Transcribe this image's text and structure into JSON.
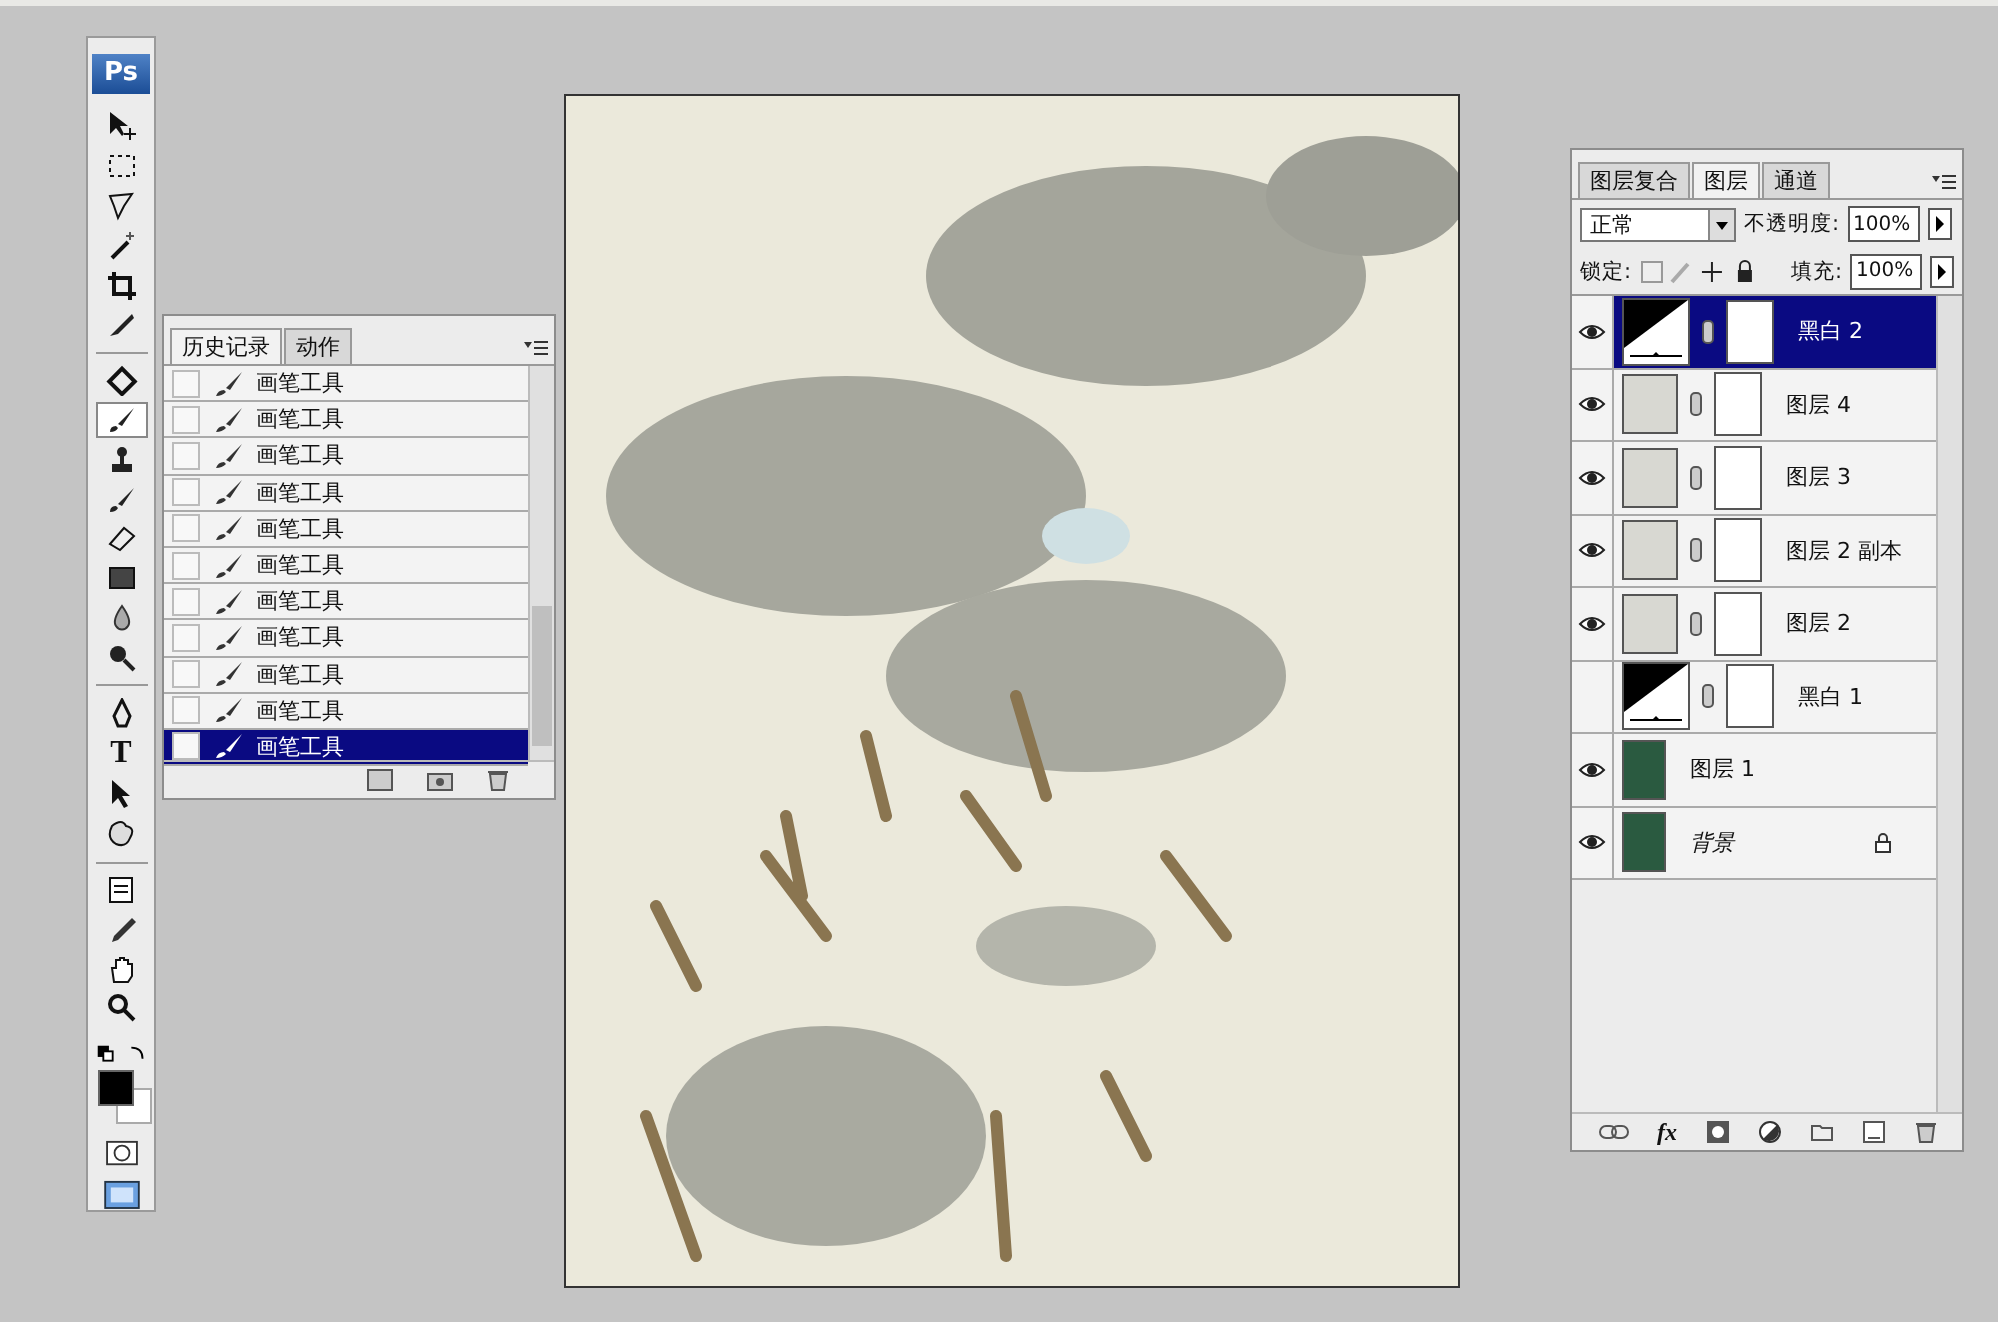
{
  "toolbar": {
    "logo": "Ps",
    "tools": [
      {
        "kind": "move",
        "selected": false
      },
      {
        "kind": "marquee",
        "selected": false
      },
      {
        "kind": "lasso",
        "selected": false
      },
      {
        "kind": "wand",
        "selected": false
      },
      {
        "kind": "crop",
        "selected": false
      },
      {
        "kind": "slice",
        "selected": false
      },
      {
        "kind": "heal",
        "selected": false
      },
      {
        "kind": "brush",
        "selected": true
      },
      {
        "kind": "stamp",
        "selected": false
      },
      {
        "kind": "historybrush",
        "selected": false
      },
      {
        "kind": "eraser",
        "selected": false
      },
      {
        "kind": "gradient",
        "selected": false
      },
      {
        "kind": "blur",
        "selected": false
      },
      {
        "kind": "dodge",
        "selected": false
      },
      {
        "kind": "pen",
        "selected": false
      },
      {
        "kind": "text",
        "selected": false
      },
      {
        "kind": "select",
        "selected": false
      },
      {
        "kind": "shape",
        "selected": false
      },
      {
        "kind": "notes",
        "selected": false
      },
      {
        "kind": "eyedropper",
        "selected": false
      },
      {
        "kind": "hand",
        "selected": false
      },
      {
        "kind": "zoom",
        "selected": false
      }
    ],
    "text_tool_glyph": "T"
  },
  "history_panel": {
    "tabs": [
      {
        "label": "历史记录",
        "selected": true
      },
      {
        "label": "动作",
        "selected": false
      }
    ],
    "items": [
      {
        "label": "画笔工具",
        "selected": false
      },
      {
        "label": "画笔工具",
        "selected": false
      },
      {
        "label": "画笔工具",
        "selected": false
      },
      {
        "label": "画笔工具",
        "selected": false
      },
      {
        "label": "画笔工具",
        "selected": false
      },
      {
        "label": "画笔工具",
        "selected": false
      },
      {
        "label": "画笔工具",
        "selected": false
      },
      {
        "label": "画笔工具",
        "selected": false
      },
      {
        "label": "画笔工具",
        "selected": false
      },
      {
        "label": "画笔工具",
        "selected": false
      },
      {
        "label": "画笔工具",
        "selected": true
      }
    ]
  },
  "layers_panel": {
    "tabs": [
      {
        "label": "图层复合",
        "selected": false
      },
      {
        "label": "图层",
        "selected": true
      },
      {
        "label": "通道",
        "selected": false
      }
    ],
    "style_button": "fx",
    "blend_mode": "正常",
    "opacity_label": "不透明度:",
    "opacity": "100%",
    "lock_label": "锁定:",
    "fill_label": "填充:",
    "fill": "100%",
    "layers": [
      {
        "name": "黑白 2",
        "kind": "adjustment",
        "visible": true,
        "selected": true
      },
      {
        "name": "图层 4",
        "kind": "masked",
        "visible": true,
        "selected": false
      },
      {
        "name": "图层 3",
        "kind": "masked",
        "visible": true,
        "selected": false
      },
      {
        "name": "图层 2 副本",
        "kind": "masked",
        "visible": true,
        "selected": false
      },
      {
        "name": "图层 2",
        "kind": "masked",
        "visible": true,
        "selected": false
      },
      {
        "name": "黑白 1",
        "kind": "adjustment",
        "visible": false,
        "selected": false
      },
      {
        "name": "图层 1",
        "kind": "plain",
        "visible": true,
        "selected": false
      },
      {
        "name": "背景",
        "kind": "background",
        "visible": true,
        "selected": false
      }
    ]
  }
}
